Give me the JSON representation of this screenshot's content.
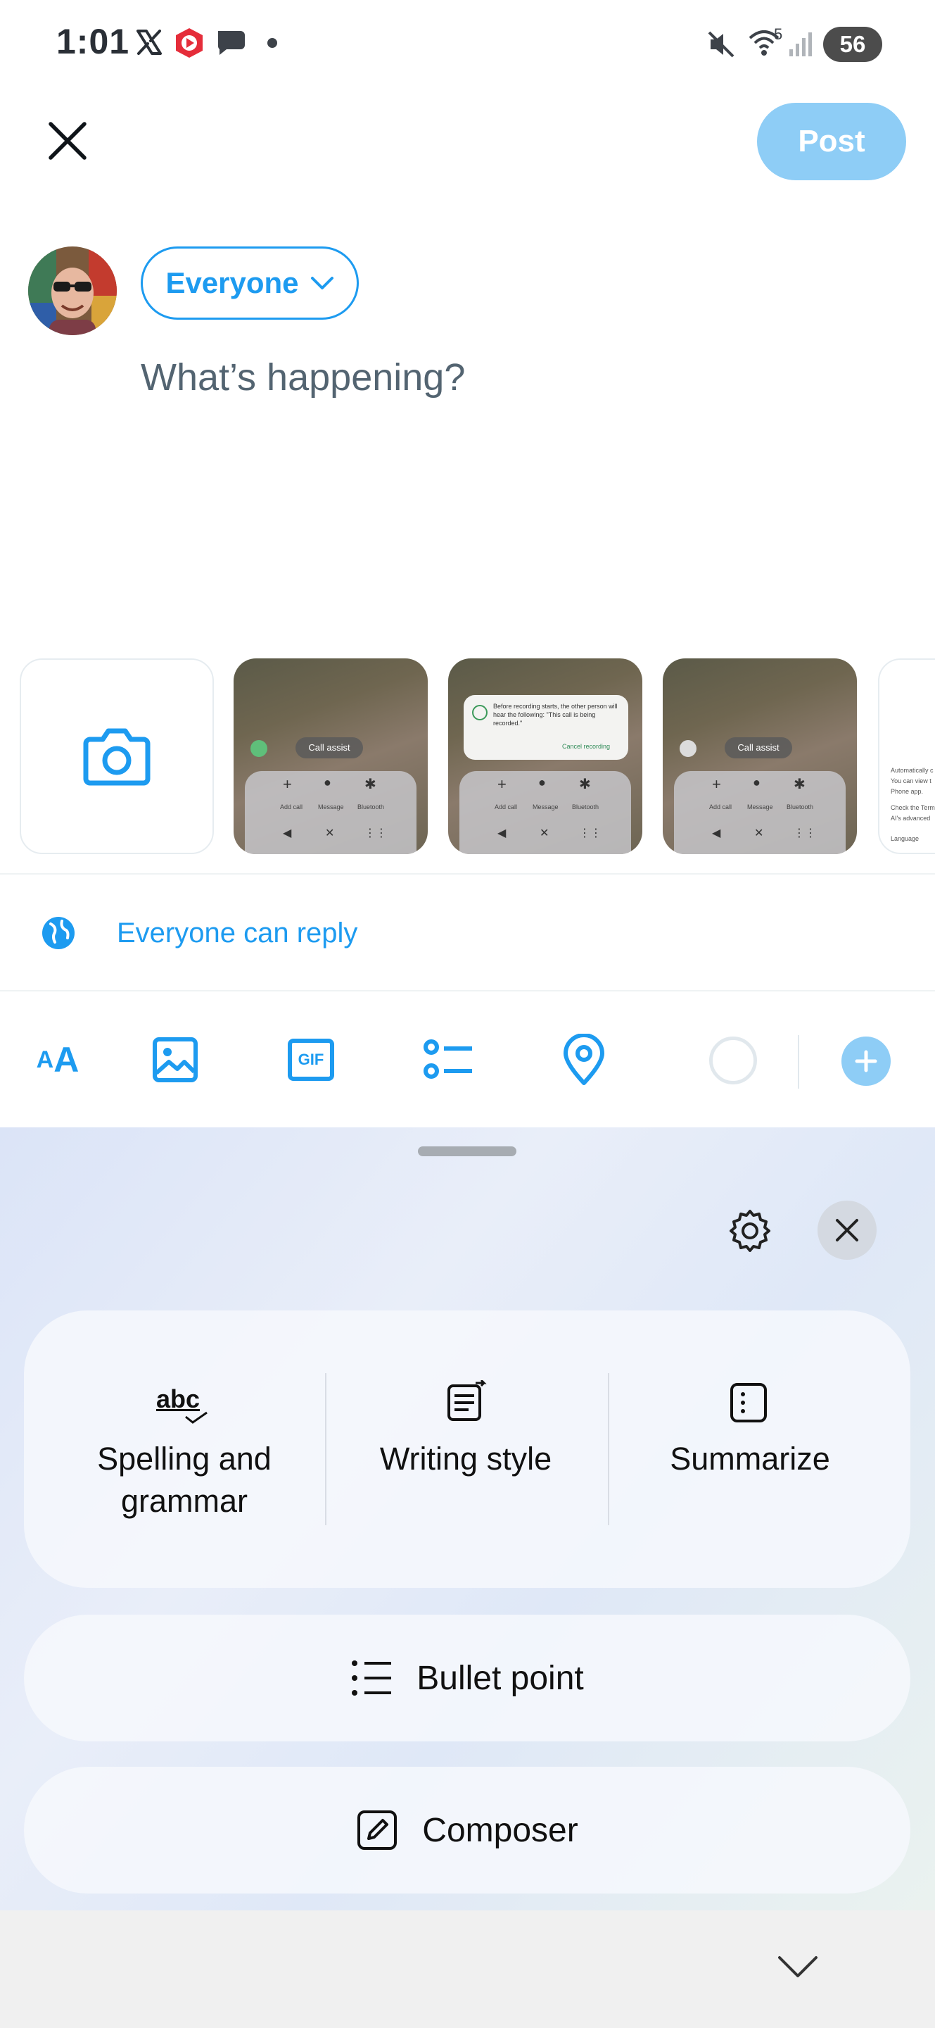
{
  "status_bar": {
    "time": "1:01",
    "battery": "56",
    "wifi_badge": "5"
  },
  "compose": {
    "post_label": "Post",
    "audience_label": "Everyone",
    "placeholder": "What’s happening?",
    "reply_setting": "Everyone can reply"
  },
  "media_strip": {
    "thumbnails": [
      {
        "chip": "Call assist",
        "labels": [
          "Add call",
          "Message",
          "Bluetooth"
        ]
      },
      {
        "dialog_text": "Before recording starts, the other person will hear the following: \"This call is being recorded.\"",
        "dialog_action": "Cancel recording",
        "labels": [
          "Add call",
          "Message",
          "Bluetooth"
        ]
      },
      {
        "chip": "Call assist",
        "labels": [
          "Add call",
          "Message",
          "Bluetooth"
        ]
      }
    ],
    "partial_thumbnail_lines": [
      "Automatically c",
      "You can view t",
      "Phone app.",
      "Check the Term",
      "AI's advanced",
      "Language"
    ]
  },
  "toolbar": {
    "icons": [
      "text-format-icon",
      "image-icon",
      "gif-icon",
      "poll-icon",
      "location-icon",
      "character-count-ring",
      "add-thread-icon"
    ],
    "gif_label": "GIF"
  },
  "assistant_panel": {
    "tools": [
      {
        "icon": "abc",
        "label": "Spelling and grammar"
      },
      {
        "icon": "writing-style-icon",
        "label": "Writing style"
      },
      {
        "icon": "summarize-icon",
        "label": "Summarize"
      }
    ],
    "bullet_point": "Bullet point",
    "composer": "Composer"
  },
  "colors": {
    "accent": "#1d9bf0",
    "post_disabled": "#8ecdf6",
    "sheet_tint": "#dfe7f7"
  }
}
